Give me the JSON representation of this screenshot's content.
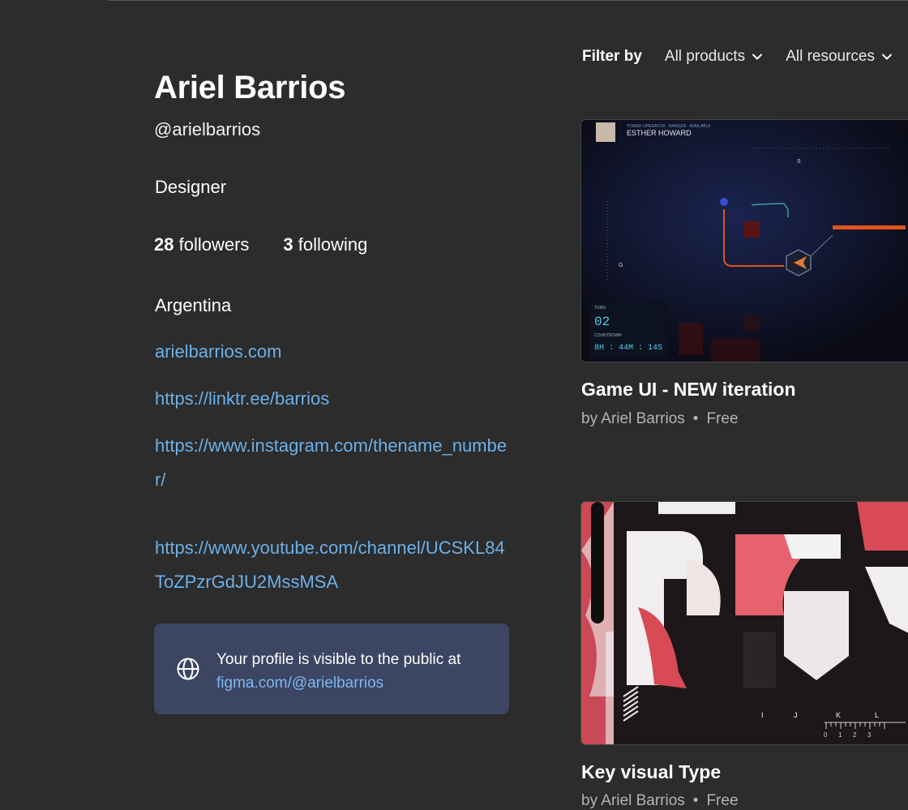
{
  "profile": {
    "name": "Ariel Barrios",
    "handle": "@arielbarrios",
    "role": "Designer",
    "followers_count": "28",
    "followers_label": " followers",
    "following_count": "3",
    "following_label": " following",
    "location": "Argentina",
    "links": [
      "arielbarrios.com",
      "https://linktr.ee/barrios",
      "https://www.instagram.com/thename_number/",
      "https://www.youtube.com/channel/UCSKL84ToZPzrGdJU2MssMSA"
    ],
    "notice_text": "Your profile is visible to the public at",
    "notice_link": "figma.com/@arielbarrios"
  },
  "filters": {
    "label": "Filter by",
    "products": "All products",
    "resources": "All resources"
  },
  "cards": [
    {
      "title": "Game UI - NEW iteration",
      "author": "by Ariel Barrios",
      "price": "Free",
      "thumb": {
        "operator": "TOWER OPERATOR - RANGER - AVAILABLE",
        "player": "ESTHER HOWARD",
        "turn_label": "TURN",
        "turn": "02",
        "countdown_label": "COUNTDOWN",
        "countdown": "8H : 44M : 14S",
        "compass_s": "S",
        "compass_g": "G"
      }
    },
    {
      "title": "Key visual Type",
      "author": "by Ariel Barrios",
      "price": "Free",
      "thumb": {
        "letters": [
          "I",
          "J",
          "K",
          "L"
        ],
        "ruler": [
          "0",
          "1",
          "2",
          "3"
        ]
      }
    }
  ],
  "colors": {
    "background": "#2c2c2c",
    "link": "#6cb0e8",
    "notice_bg": "#3c4562"
  },
  "dot": "•"
}
